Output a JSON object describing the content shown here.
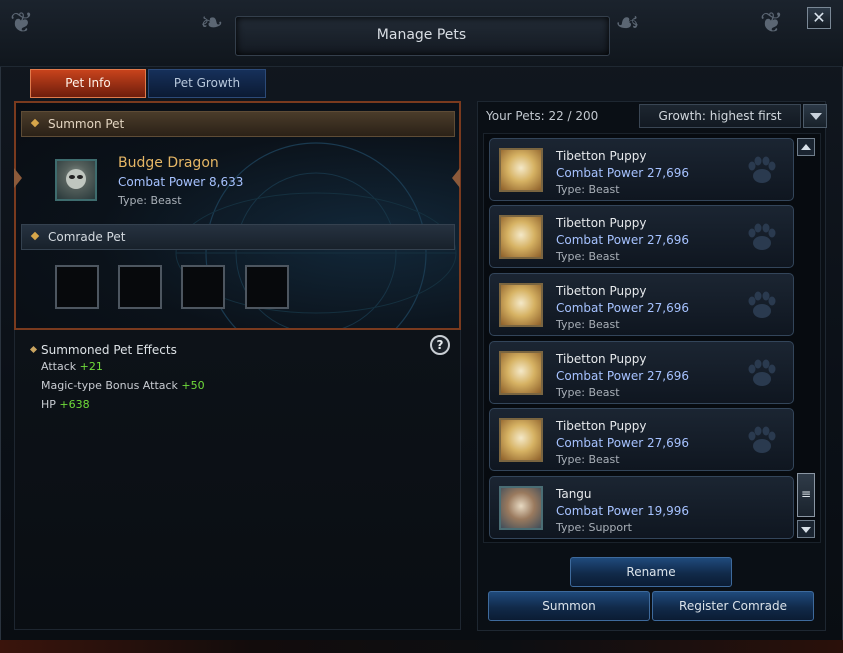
{
  "window": {
    "title": "Manage Pets",
    "close_label": "✕"
  },
  "tabs": [
    {
      "label": "Pet Info",
      "active": true
    },
    {
      "label": "Pet Growth",
      "active": false
    }
  ],
  "summon": {
    "section_label": "Summon Pet",
    "pet_name": "Budge Dragon",
    "combat_power": "Combat Power 8,633",
    "type": "Type: Beast",
    "icon": "budge-dragon-portrait"
  },
  "comrade": {
    "section_label": "Comrade Pet",
    "slots": [
      "",
      "",
      "",
      ""
    ]
  },
  "effects": {
    "title": "Summoned Pet Effects",
    "lines": [
      {
        "label": "Attack",
        "value": "+21"
      },
      {
        "label": "Magic-type Bonus Attack",
        "value": "+50"
      },
      {
        "label": "HP",
        "value": "+638"
      }
    ],
    "help_label": "?"
  },
  "pet_list": {
    "count_label": "Your Pets: 22 / 200",
    "sort_label": "Growth: highest first",
    "items": [
      {
        "name": "Tibetton Puppy",
        "combat_power": "Combat Power 27,696",
        "type": "Type: Beast",
        "icon": "tibetton-puppy-portrait"
      },
      {
        "name": "Tibetton Puppy",
        "combat_power": "Combat Power 27,696",
        "type": "Type: Beast",
        "icon": "tibetton-puppy-portrait"
      },
      {
        "name": "Tibetton Puppy",
        "combat_power": "Combat Power 27,696",
        "type": "Type: Beast",
        "icon": "tibetton-puppy-portrait"
      },
      {
        "name": "Tibetton Puppy",
        "combat_power": "Combat Power 27,696",
        "type": "Type: Beast",
        "icon": "tibetton-puppy-portrait"
      },
      {
        "name": "Tibetton Puppy",
        "combat_power": "Combat Power 27,696",
        "type": "Type: Beast",
        "icon": "tibetton-puppy-portrait"
      },
      {
        "name": "Tangu",
        "combat_power": "Combat Power 19,996",
        "type": "Type: Support",
        "icon": "tangu-portrait"
      }
    ],
    "scroll_thumb_label": "≡"
  },
  "actions": {
    "rename": "Rename",
    "summon": "Summon",
    "register_comrade": "Register Comrade"
  },
  "colors": {
    "accent_tab": "#c8431c",
    "combat_power": "#a6c2ff",
    "pet_name_gold": "#e5b665",
    "bonus_green": "#6fdc3a"
  }
}
